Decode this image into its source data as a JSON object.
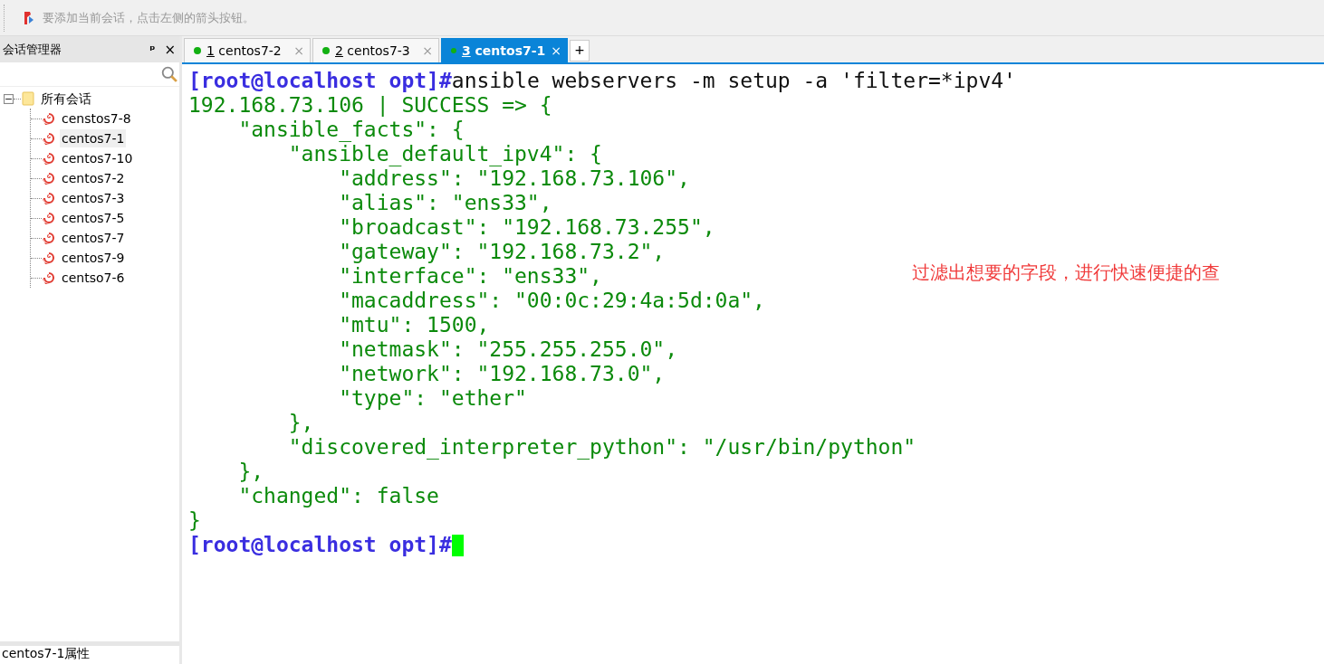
{
  "toolbar": {
    "hint": "要添加当前会话，点击左侧的箭头按钮。"
  },
  "sidebar": {
    "title": "会话管理器",
    "pin": "ᵖ",
    "close": "×",
    "tree": [
      {
        "label": "所有会话",
        "expanded": true,
        "children": [
          {
            "label": "censtos7-8",
            "selected": false
          },
          {
            "label": "centos7-1",
            "selected": true
          },
          {
            "label": "centos7-10",
            "selected": false
          },
          {
            "label": "centos7-2",
            "selected": false
          },
          {
            "label": "centos7-3",
            "selected": false
          },
          {
            "label": "centos7-5",
            "selected": false
          },
          {
            "label": "centos7-7",
            "selected": false
          },
          {
            "label": "centos7-9",
            "selected": false
          },
          {
            "label": "centso7-6",
            "selected": false
          }
        ]
      }
    ],
    "properties_title": "centos7-1属性"
  },
  "tabs": [
    {
      "number": "1",
      "label": "centos7-2",
      "selected": false,
      "close": "×"
    },
    {
      "number": "2",
      "label": "centos7-3",
      "selected": false,
      "close": "×"
    },
    {
      "number": "3",
      "label": "centos7-1",
      "selected": true,
      "close": "×"
    }
  ],
  "new_tab": "+",
  "terminal": {
    "lines": [
      [
        {
          "kind": "prompt",
          "text": "[root@localhost opt]#"
        },
        {
          "kind": "command",
          "text": "ansible webservers -m setup -a 'filter=*ipv4'"
        }
      ],
      [
        {
          "kind": "output",
          "text": "192.168.73.106 | SUCCESS => {"
        }
      ],
      [
        {
          "kind": "output",
          "text": "    \"ansible_facts\": {"
        }
      ],
      [
        {
          "kind": "output",
          "text": "        \"ansible_default_ipv4\": {"
        }
      ],
      [
        {
          "kind": "output",
          "text": "            \"address\": \"192.168.73.106\","
        }
      ],
      [
        {
          "kind": "output",
          "text": "            \"alias\": \"ens33\","
        }
      ],
      [
        {
          "kind": "output",
          "text": "            \"broadcast\": \"192.168.73.255\","
        }
      ],
      [
        {
          "kind": "output",
          "text": "            \"gateway\": \"192.168.73.2\","
        }
      ],
      [
        {
          "kind": "output",
          "text": "            \"interface\": \"ens33\","
        }
      ],
      [
        {
          "kind": "output",
          "text": "            \"macaddress\": \"00:0c:29:4a:5d:0a\","
        }
      ],
      [
        {
          "kind": "output",
          "text": "            \"mtu\": 1500,"
        }
      ],
      [
        {
          "kind": "output",
          "text": "            \"netmask\": \"255.255.255.0\","
        }
      ],
      [
        {
          "kind": "output",
          "text": "            \"network\": \"192.168.73.0\","
        }
      ],
      [
        {
          "kind": "output",
          "text": "            \"type\": \"ether\""
        }
      ],
      [
        {
          "kind": "output",
          "text": "        },"
        }
      ],
      [
        {
          "kind": "output",
          "text": "        \"discovered_interpreter_python\": \"/usr/bin/python\""
        }
      ],
      [
        {
          "kind": "output",
          "text": "    },"
        }
      ],
      [
        {
          "kind": "output",
          "text": "    \"changed\": false"
        }
      ],
      [
        {
          "kind": "output",
          "text": "}"
        }
      ],
      [
        {
          "kind": "prompt",
          "text": "[root@localhost opt]#"
        },
        {
          "kind": "cursor"
        }
      ]
    ],
    "annotation": "过滤出想要的字段，进行快速便捷的查"
  }
}
